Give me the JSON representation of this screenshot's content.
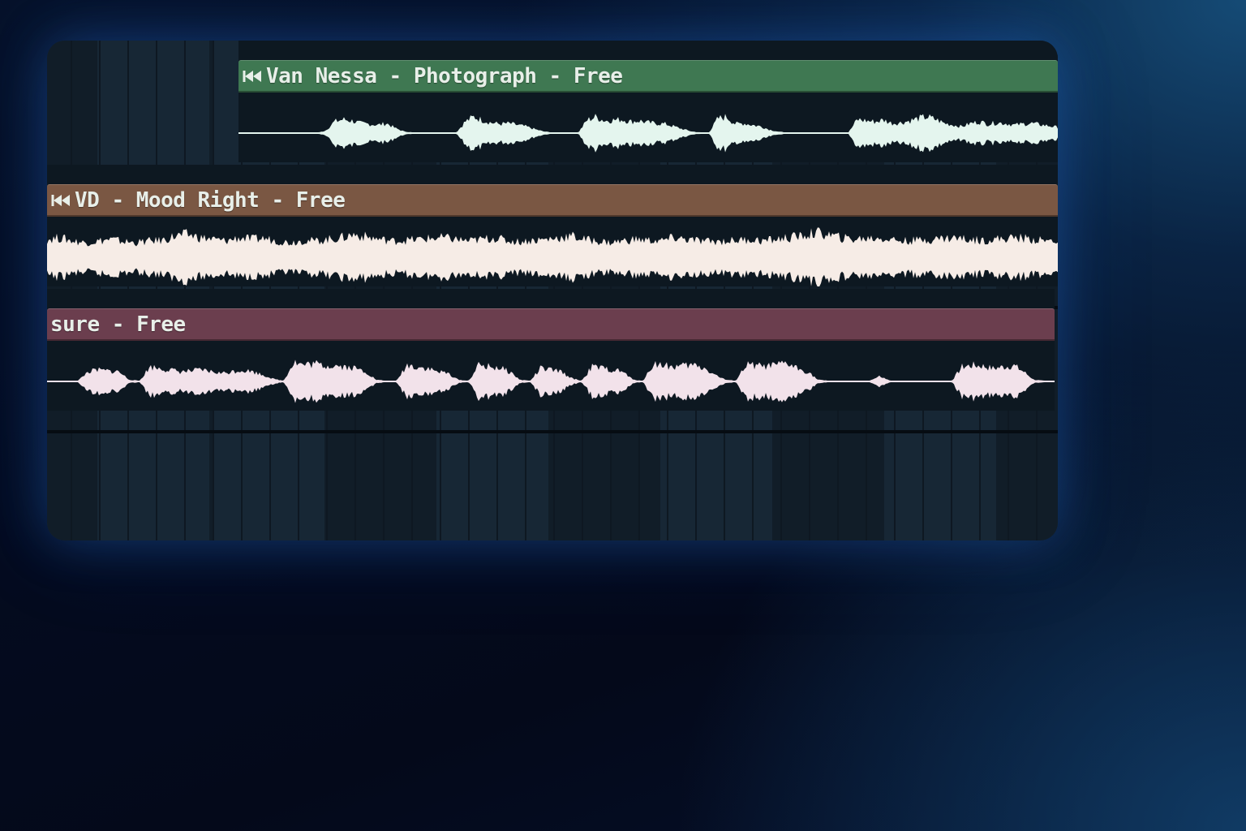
{
  "playlist": {
    "tracks": [
      {
        "clip_name": "Van Nessa - Photograph - Free",
        "header_color": "#3f7852",
        "wave_color": "#e4f5ee",
        "icon": "audio-clip-icon",
        "waveform_envelope": [
          0,
          0,
          0,
          0,
          0,
          0,
          0,
          0,
          0,
          0,
          0.08,
          0.35,
          0.42,
          0.38,
          0.3,
          0.28,
          0.25,
          0.3,
          0.15,
          0.05,
          0.02,
          0.02,
          0.02,
          0.02,
          0.02,
          0.02,
          0.35,
          0.5,
          0.4,
          0.32,
          0.28,
          0.3,
          0.25,
          0.2,
          0.12,
          0.05,
          0.02,
          0.02,
          0.02,
          0.02,
          0.4,
          0.5,
          0.38,
          0.4,
          0.42,
          0.35,
          0.38,
          0.32,
          0.3,
          0.28,
          0.2,
          0.12,
          0.05,
          0.02,
          0.02,
          0.45,
          0.5,
          0.28,
          0.3,
          0.25,
          0.2,
          0.1,
          0.04,
          0.02,
          0.02,
          0.02,
          0.02,
          0.02,
          0.02,
          0.02,
          0.02,
          0.42,
          0.38,
          0.35,
          0.4,
          0.3,
          0.32,
          0.38,
          0.45,
          0.5,
          0.42,
          0.3,
          0.25,
          0.2,
          0.3,
          0.35,
          0.28,
          0.32,
          0.3,
          0.25,
          0.28,
          0.3,
          0.26,
          0.22,
          0.18
        ]
      },
      {
        "clip_name": "VD - Mood Right - Free",
        "header_color": "#7a5743",
        "wave_color": "#f6ece6",
        "icon": "audio-clip-icon",
        "waveform_envelope": [
          0.55,
          0.6,
          0.5,
          0.45,
          0.5,
          0.55,
          0.48,
          0.45,
          0.5,
          0.52,
          0.65,
          0.7,
          0.6,
          0.55,
          0.5,
          0.6,
          0.55,
          0.58,
          0.5,
          0.45,
          0.52,
          0.5,
          0.55,
          0.6,
          0.7,
          0.62,
          0.55,
          0.5,
          0.52,
          0.55,
          0.58,
          0.6,
          0.55,
          0.5,
          0.55,
          0.6,
          0.5,
          0.48,
          0.52,
          0.55,
          0.6,
          0.65,
          0.55,
          0.5,
          0.45,
          0.5,
          0.55,
          0.52,
          0.5,
          0.6,
          0.55,
          0.5,
          0.48,
          0.5,
          0.52,
          0.55,
          0.5,
          0.55,
          0.6,
          0.65,
          0.75,
          0.7,
          0.6,
          0.55,
          0.58,
          0.6,
          0.55,
          0.5,
          0.52,
          0.55,
          0.58,
          0.6,
          0.55,
          0.52,
          0.55,
          0.58,
          0.6,
          0.55,
          0.5,
          0.52
        ]
      },
      {
        "clip_name": "sure - Free",
        "header_color": "#6b3e4e",
        "wave_color": "#f2e2ea",
        "icon": "",
        "waveform_envelope": [
          0.02,
          0.02,
          0.02,
          0.02,
          0.3,
          0.35,
          0.32,
          0.3,
          0.05,
          0.02,
          0.45,
          0.4,
          0.35,
          0.3,
          0.32,
          0.35,
          0.3,
          0.25,
          0.3,
          0.35,
          0.3,
          0.2,
          0.08,
          0.02,
          0.6,
          0.5,
          0.55,
          0.48,
          0.5,
          0.45,
          0.4,
          0.3,
          0.05,
          0.02,
          0.02,
          0.5,
          0.45,
          0.4,
          0.3,
          0.25,
          0.05,
          0.02,
          0.5,
          0.45,
          0.42,
          0.3,
          0.05,
          0.02,
          0.4,
          0.35,
          0.3,
          0.1,
          0.02,
          0.45,
          0.4,
          0.35,
          0.3,
          0.05,
          0.02,
          0.55,
          0.5,
          0.45,
          0.48,
          0.5,
          0.4,
          0.2,
          0.05,
          0.02,
          0.5,
          0.48,
          0.45,
          0.5,
          0.55,
          0.4,
          0.3,
          0.05,
          0.02,
          0.02,
          0.02,
          0.02,
          0.02,
          0.15,
          0.02,
          0.02,
          0.02,
          0.02,
          0.02,
          0.02,
          0.02,
          0.45,
          0.5,
          0.48,
          0.4,
          0.45,
          0.5,
          0.3,
          0.05,
          0.02,
          0.02
        ]
      }
    ]
  }
}
